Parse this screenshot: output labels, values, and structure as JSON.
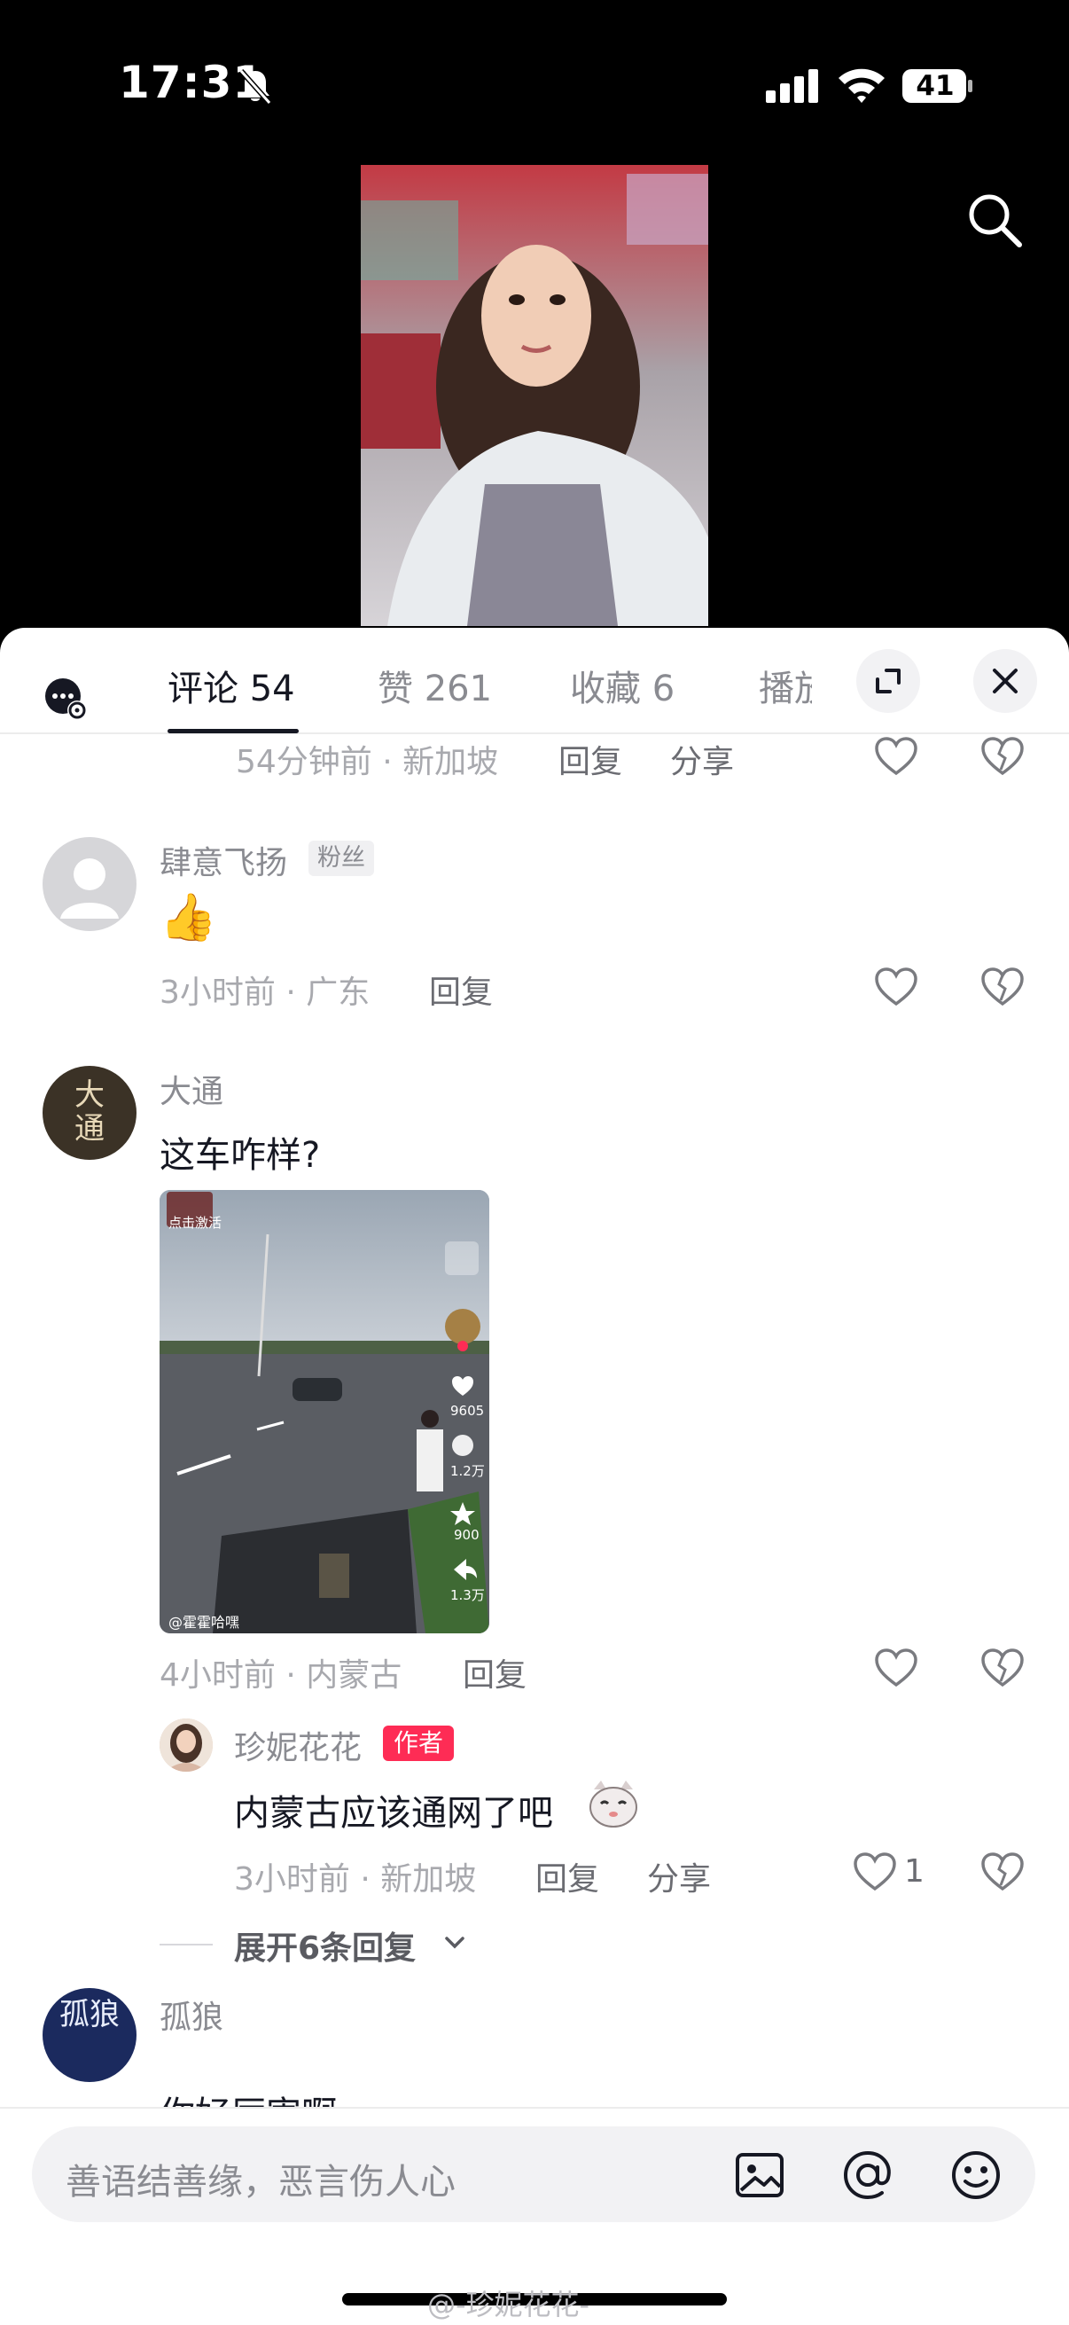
{
  "status_bar": {
    "time": "17:31",
    "battery": "41"
  },
  "tabs": [
    {
      "label": "评论 54"
    },
    {
      "label": "赞 261"
    },
    {
      "label": "收藏 6"
    },
    {
      "label": "播放"
    }
  ],
  "comments": [
    {
      "time_location": "54分钟前 · 新加坡",
      "reply": "回复",
      "share": "分享"
    },
    {
      "username": "肆意飞扬",
      "badge": "粉丝",
      "text": "👍",
      "time_location": "3小时前 · 广东",
      "reply": "回复"
    },
    {
      "username": "大通",
      "avatar_text": "大通",
      "text": "这车咋样?",
      "time_location": "4小时前 · 内蒙古",
      "reply": "回复",
      "image": {
        "top_label": "点击激活",
        "bottom_label": "@霍霍哈嘿",
        "likes": "9605",
        "comments": "1.2万",
        "stars": "900",
        "shares": "1.3万"
      }
    },
    {
      "username": "珍妮花花",
      "badge": "作者",
      "text": "内蒙古应该通网了吧",
      "time_location": "3小时前 · 新加坡",
      "reply": "回复",
      "share": "分享",
      "likes": "1"
    },
    {
      "username": "孤狼",
      "avatar_text": "孤狼",
      "text": "你好厉害啊"
    }
  ],
  "expand_replies": "展开6条回复",
  "input": {
    "placeholder": "善语结善缘，恶言伤人心"
  },
  "watermark": "@-珍妮花花-",
  "colors": {
    "accent": "#fe2c55",
    "text_primary": "#161823",
    "text_secondary": "#8a8b91"
  }
}
